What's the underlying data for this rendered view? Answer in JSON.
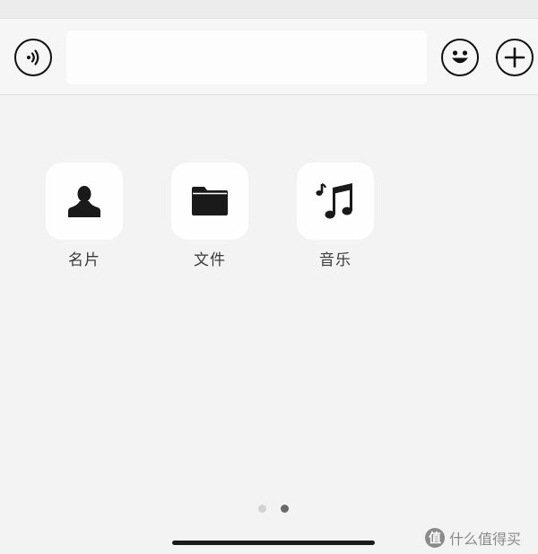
{
  "input_bar": {
    "voice_icon": "voice-input-icon",
    "emoji_icon": "emoji-icon",
    "plus_icon": "plus-icon",
    "text_field_value": ""
  },
  "panel": {
    "tiles": [
      {
        "label": "名片",
        "icon": "person-icon"
      },
      {
        "label": "文件",
        "icon": "folder-icon"
      },
      {
        "label": "音乐",
        "icon": "music-note-icon"
      }
    ],
    "page_count": 2,
    "current_page": 2
  },
  "watermark": {
    "logo": "值",
    "text": "什么值得买"
  },
  "colors": {
    "background": "#f3f3f3",
    "tile_background": "#fefefe",
    "icon_color": "#1a1a1a",
    "label_color": "#3a3a3a",
    "active_dot": "#6a6a6a",
    "inactive_dot": "#d2d2d2"
  }
}
